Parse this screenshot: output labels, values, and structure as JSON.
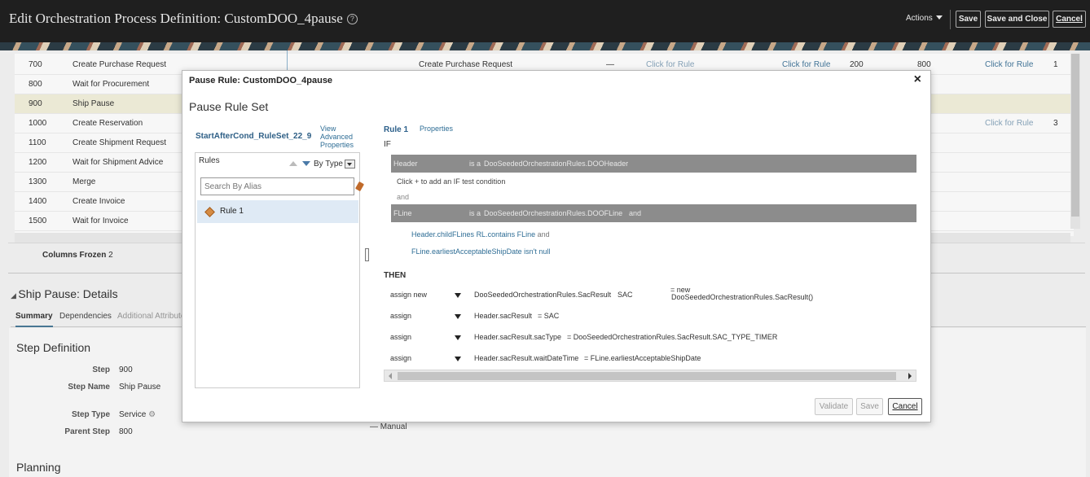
{
  "page": {
    "title": "Edit Orchestration Process Definition: CustomDOO_4pause",
    "help_icon": "?",
    "actions_label": "Actions",
    "save_label": "Save",
    "save_close_label": "Save and Close",
    "cancel_label": "Cancel"
  },
  "background_rows": [
    {
      "step": "700",
      "name": "Create Purchase Request",
      "col3": "Create Purchase Request",
      "col4": "—",
      "col5": "Click for Rule",
      "col6": "Click for Rule",
      "col7": "200",
      "col8": "800",
      "col9": "Click for Rule",
      "col10": "1"
    },
    {
      "step": "800",
      "name": "Wait for Procurement"
    },
    {
      "step": "900",
      "name": "Ship Pause"
    },
    {
      "step": "1000",
      "name": "Create Reservation",
      "col9": "Click for Rule",
      "col10": "3"
    },
    {
      "step": "1100",
      "name": "Create Shipment Request"
    },
    {
      "step": "1200",
      "name": "Wait for Shipment Advice"
    },
    {
      "step": "1300",
      "name": "Merge"
    },
    {
      "step": "1400",
      "name": "Create Invoice"
    },
    {
      "step": "1500",
      "name": "Wait for Invoice"
    }
  ],
  "background": {
    "columns_frozen": "Columns Frozen",
    "columns_frozen_value": "2",
    "section_title": "Ship Pause: Details",
    "tabs": [
      "Summary",
      "Dependencies",
      "Additional Attributes"
    ],
    "step_definition_title": "Step Definition",
    "fields": [
      {
        "label": "Step",
        "value": "900"
      },
      {
        "label": "Step Name",
        "value": "Ship Pause"
      },
      {
        "label": "Step Type",
        "value": "Service"
      },
      {
        "label": "Parent Step",
        "value": "800"
      }
    ],
    "manual_value": "— Manual",
    "planning_title": "Planning"
  },
  "dialog": {
    "title": "Pause Rule: CustomDOO_4pause",
    "close_icon": "×",
    "ruleset_title": "Pause Rule Set",
    "ruleset_name": "StartAfterCond_RuleSet_22_9",
    "advanced_link_1": "View",
    "advanced_link_2": "Advanced",
    "advanced_link_3": "Properties",
    "rules_label": "Rules",
    "sort_label": "By Type",
    "search_placeholder": "Search By Alias",
    "rule_items": [
      "Rule 1"
    ],
    "rule_tab": "Rule 1",
    "properties_tab": "Properties",
    "if_label": "IF",
    "fact1_name": "Header",
    "fact1_isa": "is a",
    "fact1_type": "DooSeededOrchestrationRules.DOOHeader",
    "hint_text": "Click + to add an IF test condition",
    "and_label": "and",
    "fact2_name": "FLine",
    "fact2_isa": "is a",
    "fact2_type": "DooSeededOrchestrationRules.DOOFLine",
    "fact2_and": "and",
    "cond1_left": "Header.childFLines",
    "cond1_op": "RL.contains",
    "cond1_right": "FLine",
    "cond1_and": "and",
    "cond2_left": "FLine.earliestAcceptableShipDate",
    "cond2_op": "isn't null",
    "then_label": "THEN",
    "actions": [
      {
        "verb": "assign new",
        "target": "DooSeededOrchestrationRules.SacResult",
        "var": "SAC",
        "rhs_1": "= new",
        "rhs_2": "DooSeededOrchestrationRules.SacResult()"
      },
      {
        "verb": "assign",
        "target": "Header.sacResult",
        "rhs": "= SAC"
      },
      {
        "verb": "assign",
        "target": "Header.sacResult.sacType",
        "rhs": "= DooSeededOrchestrationRules.SacResult.SAC_TYPE_TIMER"
      },
      {
        "verb": "assign",
        "target": "Header.sacResult.waitDateTime",
        "rhs": "= FLine.earliestAcceptableShipDate"
      }
    ],
    "validate_label": "Validate",
    "save_label": "Save",
    "cancel_label": "Cancel"
  }
}
